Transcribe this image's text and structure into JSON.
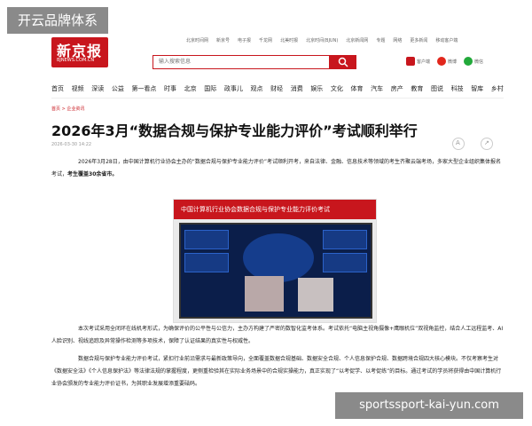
{
  "brand_tag": "开云品牌体系",
  "topbar": [
    "北京时间网",
    "新京号",
    "电子报",
    "千龙网",
    "北美时报",
    "北京时间(BJUN)",
    "北京新闻网",
    "专题",
    "网络",
    "更多新闻",
    "移动客户端"
  ],
  "logo": {
    "cn": "新京报",
    "en": "BJNEWS.COM.CN"
  },
  "search": {
    "placeholder": "输入搜索信息"
  },
  "socials": [
    {
      "label": "客户端",
      "icon": "app-icon",
      "color": "#c8161d"
    },
    {
      "label": "微博",
      "icon": "weibo-icon",
      "color": "#e2271c"
    },
    {
      "label": "微信",
      "icon": "wechat-icon",
      "color": "#22a93a"
    }
  ],
  "nav": [
    "首页",
    "视频",
    "深读",
    "公益",
    "第一看点",
    "时事",
    "北京",
    "国际",
    "政事儿",
    "观点",
    "财经",
    "消费",
    "娱乐",
    "文化",
    "体育",
    "汽车",
    "房产",
    "教育",
    "图说",
    "科技",
    "智库",
    "乡村"
  ],
  "breadcrumb": "首页 > 企业资讯",
  "article": {
    "title": "2026年3月“数据合规与保护专业能力评价”考试顺利举行",
    "date": "2026-03-30 14:22",
    "p1_a": "2026年3月28日，由中国计算机行业协会主办的“数据合规与保护专业能力评价”考试顺利开考，来自法律、金融、信息技术等领域的考生齐聚云端考场，多家大型企业组织集体报名考试，",
    "p1_b": "考生覆盖30余省市。",
    "photo_banner": "中国计算机行业协会数据合规与保护专业能力评价考试",
    "p2": "本次考试采用全闭环在线机考形式，为确保评价的公平性与公信力，主办方构建了严密的数智化监考体系。考试依托“电脑主视角摄像+鹰眼机位”双视角监控，结合人工远程监考、AI人脸识别、视线追踪及异常操作检测等多项技术，保障了认证结果的真实性与权威性。",
    "p3": "数据合规与保护专业能力评价考试，紧扣行业前沿需求与最新政策导向，全面覆盖数据合规基础、数据安全合规、个人信息保护合规、数据跨境合规四大核心模块。不仅考察考生对《数据安全法》《个人信息保护法》等法律法规的掌握程度，更侧重检验其在实际业务场景中的合规实操能力，真正实现了“以考促学、以考促练”的目标。通过考试的学员将获得由中国计算机行业协会颁发的专业能力评价证书，为其职业发展增添重要砝码。"
  },
  "watermark": "sportssport-kai-yun.com"
}
